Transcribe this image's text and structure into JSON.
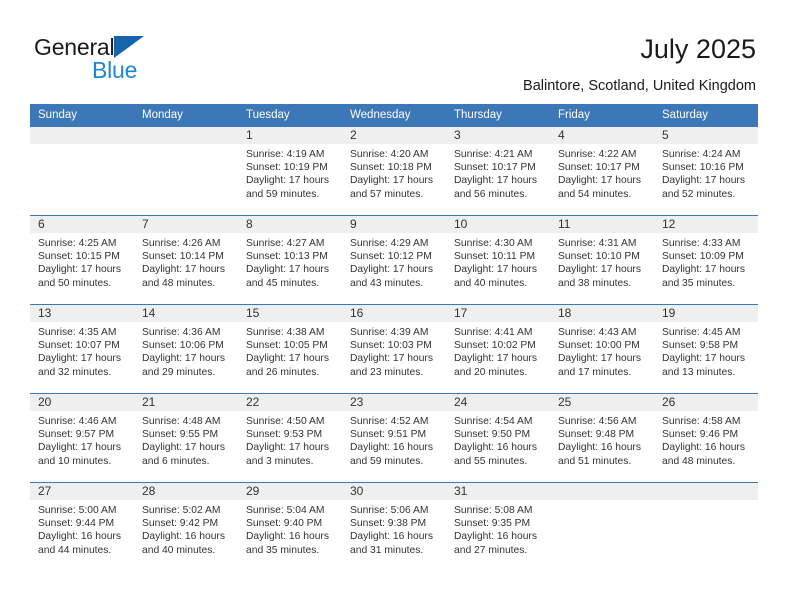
{
  "brand": {
    "name_top": "General",
    "name_bottom": "Blue",
    "triangle_color": "#1665ac",
    "top_text_color": "#1a1a1a",
    "bottom_text_color": "#1a87da"
  },
  "header": {
    "title": "July 2025",
    "subtitle": "Balintore, Scotland, United Kingdom"
  },
  "colors": {
    "header_blue": "#3c77b8",
    "daynum_band": "#efeff0",
    "text": "#333333",
    "separator": "#3c77b8"
  },
  "calendar": {
    "weekday_headers": [
      "Sunday",
      "Monday",
      "Tuesday",
      "Wednesday",
      "Thursday",
      "Friday",
      "Saturday"
    ],
    "weeks": [
      [
        {
          "day": "",
          "sunrise": "",
          "sunset": "",
          "daylight": ""
        },
        {
          "day": "",
          "sunrise": "",
          "sunset": "",
          "daylight": ""
        },
        {
          "day": "1",
          "sunrise": "Sunrise: 4:19 AM",
          "sunset": "Sunset: 10:19 PM",
          "daylight": "Daylight: 17 hours and 59 minutes."
        },
        {
          "day": "2",
          "sunrise": "Sunrise: 4:20 AM",
          "sunset": "Sunset: 10:18 PM",
          "daylight": "Daylight: 17 hours and 57 minutes."
        },
        {
          "day": "3",
          "sunrise": "Sunrise: 4:21 AM",
          "sunset": "Sunset: 10:17 PM",
          "daylight": "Daylight: 17 hours and 56 minutes."
        },
        {
          "day": "4",
          "sunrise": "Sunrise: 4:22 AM",
          "sunset": "Sunset: 10:17 PM",
          "daylight": "Daylight: 17 hours and 54 minutes."
        },
        {
          "day": "5",
          "sunrise": "Sunrise: 4:24 AM",
          "sunset": "Sunset: 10:16 PM",
          "daylight": "Daylight: 17 hours and 52 minutes."
        }
      ],
      [
        {
          "day": "6",
          "sunrise": "Sunrise: 4:25 AM",
          "sunset": "Sunset: 10:15 PM",
          "daylight": "Daylight: 17 hours and 50 minutes."
        },
        {
          "day": "7",
          "sunrise": "Sunrise: 4:26 AM",
          "sunset": "Sunset: 10:14 PM",
          "daylight": "Daylight: 17 hours and 48 minutes."
        },
        {
          "day": "8",
          "sunrise": "Sunrise: 4:27 AM",
          "sunset": "Sunset: 10:13 PM",
          "daylight": "Daylight: 17 hours and 45 minutes."
        },
        {
          "day": "9",
          "sunrise": "Sunrise: 4:29 AM",
          "sunset": "Sunset: 10:12 PM",
          "daylight": "Daylight: 17 hours and 43 minutes."
        },
        {
          "day": "10",
          "sunrise": "Sunrise: 4:30 AM",
          "sunset": "Sunset: 10:11 PM",
          "daylight": "Daylight: 17 hours and 40 minutes."
        },
        {
          "day": "11",
          "sunrise": "Sunrise: 4:31 AM",
          "sunset": "Sunset: 10:10 PM",
          "daylight": "Daylight: 17 hours and 38 minutes."
        },
        {
          "day": "12",
          "sunrise": "Sunrise: 4:33 AM",
          "sunset": "Sunset: 10:09 PM",
          "daylight": "Daylight: 17 hours and 35 minutes."
        }
      ],
      [
        {
          "day": "13",
          "sunrise": "Sunrise: 4:35 AM",
          "sunset": "Sunset: 10:07 PM",
          "daylight": "Daylight: 17 hours and 32 minutes."
        },
        {
          "day": "14",
          "sunrise": "Sunrise: 4:36 AM",
          "sunset": "Sunset: 10:06 PM",
          "daylight": "Daylight: 17 hours and 29 minutes."
        },
        {
          "day": "15",
          "sunrise": "Sunrise: 4:38 AM",
          "sunset": "Sunset: 10:05 PM",
          "daylight": "Daylight: 17 hours and 26 minutes."
        },
        {
          "day": "16",
          "sunrise": "Sunrise: 4:39 AM",
          "sunset": "Sunset: 10:03 PM",
          "daylight": "Daylight: 17 hours and 23 minutes."
        },
        {
          "day": "17",
          "sunrise": "Sunrise: 4:41 AM",
          "sunset": "Sunset: 10:02 PM",
          "daylight": "Daylight: 17 hours and 20 minutes."
        },
        {
          "day": "18",
          "sunrise": "Sunrise: 4:43 AM",
          "sunset": "Sunset: 10:00 PM",
          "daylight": "Daylight: 17 hours and 17 minutes."
        },
        {
          "day": "19",
          "sunrise": "Sunrise: 4:45 AM",
          "sunset": "Sunset: 9:58 PM",
          "daylight": "Daylight: 17 hours and 13 minutes."
        }
      ],
      [
        {
          "day": "20",
          "sunrise": "Sunrise: 4:46 AM",
          "sunset": "Sunset: 9:57 PM",
          "daylight": "Daylight: 17 hours and 10 minutes."
        },
        {
          "day": "21",
          "sunrise": "Sunrise: 4:48 AM",
          "sunset": "Sunset: 9:55 PM",
          "daylight": "Daylight: 17 hours and 6 minutes."
        },
        {
          "day": "22",
          "sunrise": "Sunrise: 4:50 AM",
          "sunset": "Sunset: 9:53 PM",
          "daylight": "Daylight: 17 hours and 3 minutes."
        },
        {
          "day": "23",
          "sunrise": "Sunrise: 4:52 AM",
          "sunset": "Sunset: 9:51 PM",
          "daylight": "Daylight: 16 hours and 59 minutes."
        },
        {
          "day": "24",
          "sunrise": "Sunrise: 4:54 AM",
          "sunset": "Sunset: 9:50 PM",
          "daylight": "Daylight: 16 hours and 55 minutes."
        },
        {
          "day": "25",
          "sunrise": "Sunrise: 4:56 AM",
          "sunset": "Sunset: 9:48 PM",
          "daylight": "Daylight: 16 hours and 51 minutes."
        },
        {
          "day": "26",
          "sunrise": "Sunrise: 4:58 AM",
          "sunset": "Sunset: 9:46 PM",
          "daylight": "Daylight: 16 hours and 48 minutes."
        }
      ],
      [
        {
          "day": "27",
          "sunrise": "Sunrise: 5:00 AM",
          "sunset": "Sunset: 9:44 PM",
          "daylight": "Daylight: 16 hours and 44 minutes."
        },
        {
          "day": "28",
          "sunrise": "Sunrise: 5:02 AM",
          "sunset": "Sunset: 9:42 PM",
          "daylight": "Daylight: 16 hours and 40 minutes."
        },
        {
          "day": "29",
          "sunrise": "Sunrise: 5:04 AM",
          "sunset": "Sunset: 9:40 PM",
          "daylight": "Daylight: 16 hours and 35 minutes."
        },
        {
          "day": "30",
          "sunrise": "Sunrise: 5:06 AM",
          "sunset": "Sunset: 9:38 PM",
          "daylight": "Daylight: 16 hours and 31 minutes."
        },
        {
          "day": "31",
          "sunrise": "Sunrise: 5:08 AM",
          "sunset": "Sunset: 9:35 PM",
          "daylight": "Daylight: 16 hours and 27 minutes."
        },
        {
          "day": "",
          "sunrise": "",
          "sunset": "",
          "daylight": ""
        },
        {
          "day": "",
          "sunrise": "",
          "sunset": "",
          "daylight": ""
        }
      ]
    ]
  }
}
